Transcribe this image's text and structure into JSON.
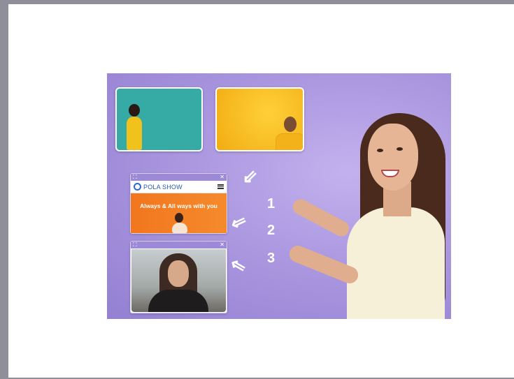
{
  "banner": {
    "website_pip": {
      "logo_text": "POLA SHOW",
      "hero_text": "Always & All ways with you"
    },
    "steps": [
      "1",
      "2",
      "3"
    ],
    "colors": {
      "background": "#a997e0",
      "teal": "#36aaa4",
      "yellow": "#f5b81c",
      "orange": "#f47920",
      "pip_bar": "#9c8ad8"
    },
    "icons": {
      "expand": "expand-icon",
      "close": "close-icon",
      "menu": "menu-icon",
      "arrow": "arrow-up-left-icon"
    }
  }
}
